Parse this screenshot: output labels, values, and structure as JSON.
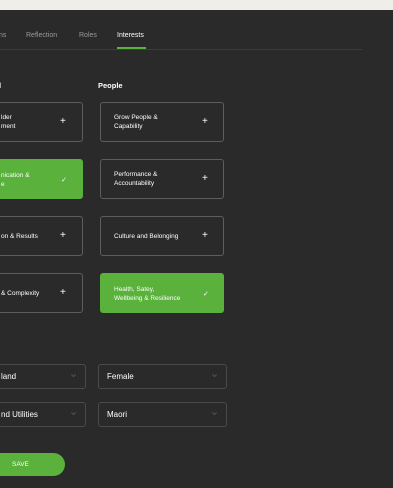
{
  "tabs": [
    {
      "label": "ns"
    },
    {
      "label": "Reflection"
    },
    {
      "label": "Roles"
    },
    {
      "label": "Interests"
    }
  ],
  "sections": {
    "left_label": "l",
    "right_label": "People"
  },
  "cards_left": [
    {
      "label": "lder\nment",
      "icon": "+"
    },
    {
      "label": "nication &\ne",
      "icon": "✓",
      "selected": true
    },
    {
      "label": "on & Results",
      "icon": "+"
    },
    {
      "label": "& Complexity",
      "icon": "+"
    }
  ],
  "cards_right": [
    {
      "label": "Grow People &\nCapability",
      "icon": "+"
    },
    {
      "label": "Performance &\nAccountability",
      "icon": "+"
    },
    {
      "label": "Culture and Belonging",
      "icon": "+"
    },
    {
      "label": "Health, Satey,\nWellbeing & Resilience",
      "icon": "✓",
      "selected": true
    }
  ],
  "selects": {
    "left_1": "land",
    "right_1": "Female",
    "left_2": "nd Utilities",
    "right_2": "Maori"
  },
  "save_label": "SAVE",
  "colors": {
    "accent": "#5ab13b",
    "background": "#2a2a2b"
  }
}
